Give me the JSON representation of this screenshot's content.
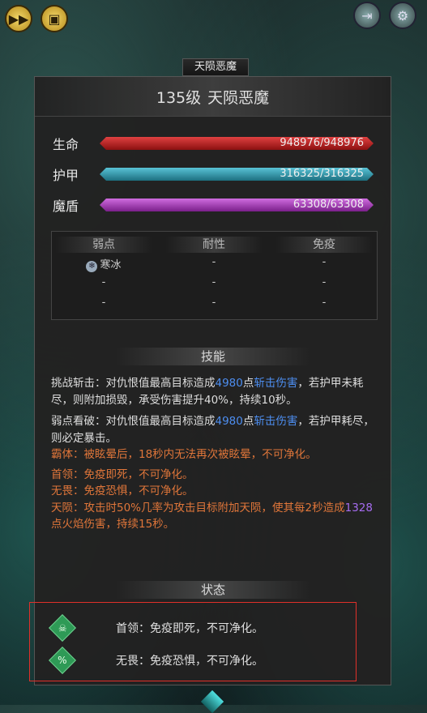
{
  "top_buttons": {
    "fast_forward_icon": "fast-forward-icon",
    "screen_icon": "screen-icon",
    "exit_icon": "exit-icon",
    "settings_icon": "gear-icon"
  },
  "boss_tag": "天陨恶魔",
  "header": {
    "level": "135级",
    "name": "天陨恶魔"
  },
  "stats": [
    {
      "label": "生命",
      "text": "948976/948976",
      "fill": 1.0,
      "color": "#c42222"
    },
    {
      "label": "护甲",
      "text": "316325/316325",
      "fill": 1.0,
      "color": "#2f9fb3"
    },
    {
      "label": "魔盾",
      "text": "63308/63308",
      "fill": 1.0,
      "color": "#b040c8"
    }
  ],
  "attributes": {
    "headers": [
      "弱点",
      "耐性",
      "免疫"
    ],
    "rows": [
      [
        "寒冰",
        "-",
        "-"
      ],
      [
        "-",
        "-",
        "-"
      ],
      [
        "-",
        "-",
        "-"
      ]
    ]
  },
  "skills_title": "技能",
  "skills": {
    "s1_a": "挑战斩击：对仇恨值最高目标造成",
    "s1_num": "4980",
    "s1_b": "点",
    "s1_dmg": "斩击伤害",
    "s1_c": "，若护甲未耗尽，则附加损毁，承受伤害提升40%，持续10秒。",
    "s2_a": "弱点看破：对仇恨值最高目标造成",
    "s2_num": "4980",
    "s2_b": "点",
    "s2_dmg": "斩击伤害",
    "s2_c": "，若护甲耗尽，则必定暴击。",
    "s3": "霸体：被眩晕后，18秒内无法再次被眩晕，不可净化。",
    "s4": "首领：免疫即死，不可净化。",
    "s5": "无畏：免疫恐惧，不可净化。",
    "s6_a": "天陨：攻击时50%几率为攻击目标附加天陨，使其每2秒造成",
    "s6_num": "1328",
    "s6_b": "点火焰伤害，持续15秒。"
  },
  "status_title": "状态",
  "status_items": [
    {
      "icon": "skull-icon",
      "text": "首领：免疫即死，不可净化。"
    },
    {
      "icon": "percent-icon",
      "text": "无畏：免疫恐惧，不可净化。"
    }
  ],
  "colors": {
    "highlight_border": "#e0302a",
    "status_icon": "#2e9a56",
    "skill_orange": "#e0763a",
    "number_blue": "#4d8ef0",
    "number_purple": "#a66cf0"
  }
}
